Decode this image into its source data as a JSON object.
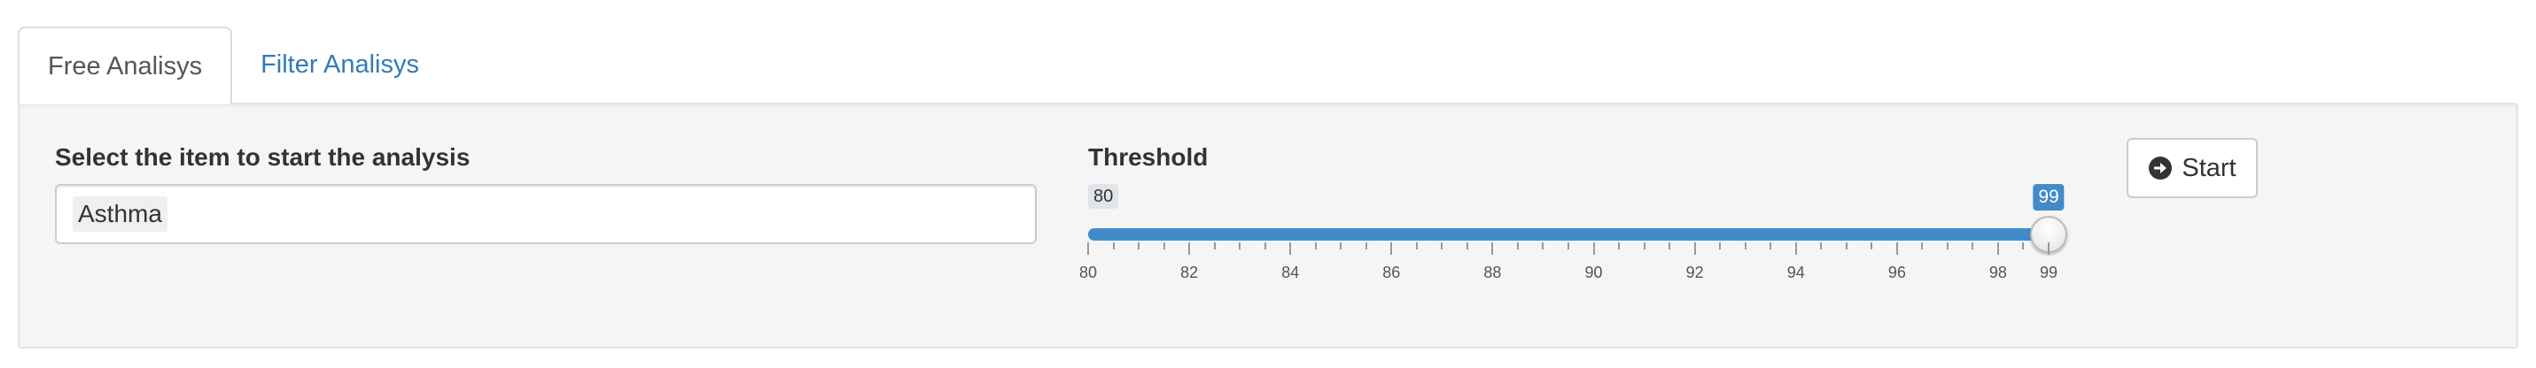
{
  "tabs": [
    {
      "label": "Free Analisys",
      "active": true
    },
    {
      "label": "Filter Analisys",
      "active": false
    }
  ],
  "item_select": {
    "label": "Select the item to start the analysis",
    "selected": "Asthma"
  },
  "threshold": {
    "label": "Threshold",
    "min": 80,
    "max": 99,
    "value": 99,
    "min_label": "80",
    "value_label": "99",
    "tick_labels": [
      "80",
      "82",
      "84",
      "86",
      "88",
      "90",
      "92",
      "94",
      "96",
      "98",
      "99"
    ]
  },
  "start_button": {
    "label": "Start",
    "icon": "circle-arrow-right-icon"
  },
  "colors": {
    "accent": "#428bca",
    "link": "#337ab7",
    "panel_bg": "#f5f5f5"
  }
}
